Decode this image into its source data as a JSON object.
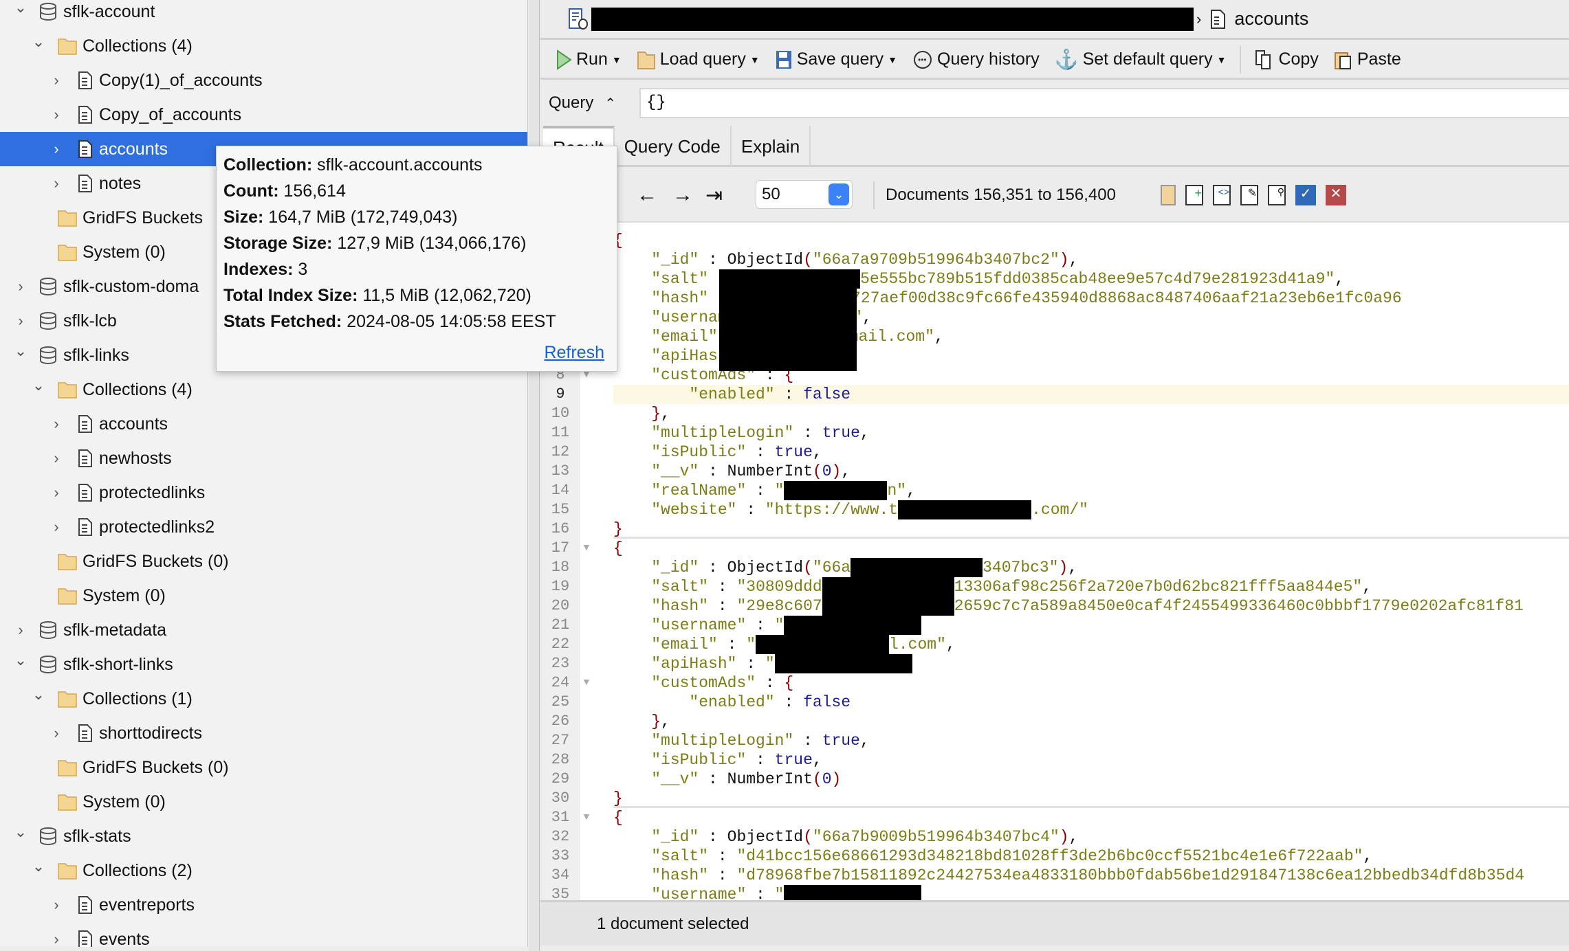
{
  "tree": [
    {
      "level": 0,
      "kind": "db",
      "expanded": true,
      "label": "sflk-account"
    },
    {
      "level": 1,
      "kind": "folder",
      "expanded": true,
      "label": "Collections (4)"
    },
    {
      "level": 2,
      "kind": "coll",
      "label": "Copy(1)_of_accounts"
    },
    {
      "level": 2,
      "kind": "coll",
      "label": "Copy_of_accounts"
    },
    {
      "level": 2,
      "kind": "coll",
      "label": "accounts",
      "selected": true
    },
    {
      "level": 2,
      "kind": "coll",
      "label": "notes"
    },
    {
      "level": 1,
      "kind": "folder",
      "leaf": true,
      "label": "GridFS Buckets"
    },
    {
      "level": 1,
      "kind": "folder",
      "leaf": true,
      "label": "System (0)"
    },
    {
      "level": 0,
      "kind": "db",
      "expanded": false,
      "label": "sflk-custom-doma"
    },
    {
      "level": 0,
      "kind": "db",
      "expanded": false,
      "label": "sflk-lcb"
    },
    {
      "level": 0,
      "kind": "db",
      "expanded": true,
      "label": "sflk-links"
    },
    {
      "level": 1,
      "kind": "folder",
      "expanded": true,
      "label": "Collections (4)"
    },
    {
      "level": 2,
      "kind": "coll",
      "label": "accounts"
    },
    {
      "level": 2,
      "kind": "coll",
      "label": "newhosts"
    },
    {
      "level": 2,
      "kind": "coll",
      "label": "protectedlinks"
    },
    {
      "level": 2,
      "kind": "coll",
      "label": "protectedlinks2"
    },
    {
      "level": 1,
      "kind": "folder",
      "leaf": true,
      "label": "GridFS Buckets (0)"
    },
    {
      "level": 1,
      "kind": "folder",
      "leaf": true,
      "label": "System (0)"
    },
    {
      "level": 0,
      "kind": "db",
      "expanded": false,
      "label": "sflk-metadata"
    },
    {
      "level": 0,
      "kind": "db",
      "expanded": true,
      "label": "sflk-short-links"
    },
    {
      "level": 1,
      "kind": "folder",
      "expanded": true,
      "label": "Collections (1)"
    },
    {
      "level": 2,
      "kind": "coll",
      "label": "shorttodirects"
    },
    {
      "level": 1,
      "kind": "folder",
      "leaf": true,
      "label": "GridFS Buckets (0)"
    },
    {
      "level": 1,
      "kind": "folder",
      "leaf": true,
      "label": "System (0)"
    },
    {
      "level": 0,
      "kind": "db",
      "expanded": true,
      "label": "sflk-stats"
    },
    {
      "level": 1,
      "kind": "folder",
      "expanded": true,
      "label": "Collections (2)"
    },
    {
      "level": 2,
      "kind": "coll",
      "label": "eventreports"
    },
    {
      "level": 2,
      "kind": "coll",
      "label": "events"
    }
  ],
  "tooltip": {
    "lines": [
      {
        "label": "Collection:",
        "value": " sflk-account.accounts"
      },
      {
        "label": "Count:",
        "value": " 156,614"
      },
      {
        "label": "Size:",
        "value": " 164,7 MiB  (172,749,043)"
      },
      {
        "label": "Storage Size:",
        "value": " 127,9 MiB  (134,066,176)"
      },
      {
        "label": "Indexes:",
        "value": " 3"
      },
      {
        "label": "Total Index Size:",
        "value": " 11,5 MiB  (12,062,720)"
      },
      {
        "label": "Stats Fetched:",
        "value": " 2024-08-05 14:05:58 EEST"
      }
    ],
    "refresh": "Refresh"
  },
  "titlebar": {
    "collection": "accounts"
  },
  "toolbar": {
    "run": "Run",
    "load": "Load query",
    "save": "Save query",
    "history": "Query history",
    "set_default": "Set default query",
    "copy": "Copy",
    "paste": "Paste"
  },
  "query": {
    "label": "Query",
    "value": "{}"
  },
  "tabs": [
    "Result",
    "Query Code",
    "Explain"
  ],
  "pager": {
    "page_size": "50",
    "range": "Documents 156,351 to 156,400"
  },
  "status": "1 document selected",
  "colors": {
    "selection": "#2f6fe0",
    "key": "#7d7d16",
    "brace": "#8b0000",
    "literal": "#1c1c9a",
    "highlight_line": "#fdf8e4"
  },
  "highlighted_line": 9,
  "code": [
    [
      [
        "p",
        "{"
      ]
    ],
    [
      [
        "i",
        "    "
      ],
      [
        "k",
        "\"_id\""
      ],
      [
        "c",
        " : "
      ],
      [
        "f",
        "ObjectId"
      ],
      [
        "p",
        "("
      ],
      [
        "s",
        "\"66a7a9709b519964b3407bc2\""
      ],
      [
        "p",
        ")"
      ],
      [
        "c",
        ","
      ]
    ],
    [
      [
        "i",
        "    "
      ],
      [
        "k",
        "\"salt\""
      ],
      [
        "c",
        " : "
      ],
      [
        "s",
        "\"b"
      ],
      [
        "x",
        ""
      ],
      [
        "s",
        "5e555bc789b515fdd0385cab48ee9e57c4d79e281923d41a9\""
      ],
      [
        "c",
        ","
      ]
    ],
    [
      [
        "i",
        "    "
      ],
      [
        "k",
        "\"hash\""
      ],
      [
        "c",
        " : "
      ],
      [
        "s",
        "\"0"
      ],
      [
        "x",
        ""
      ],
      [
        "s",
        "5f592727aef00d38c9fc66fe435940d8868ac8487406aaf21a23eb6e1fc0a96"
      ]
    ],
    [
      [
        "i",
        "    "
      ],
      [
        "k",
        "\"username\""
      ],
      [
        "x",
        ""
      ],
      [
        "s",
        "\""
      ],
      [
        "c",
        ","
      ]
    ],
    [
      [
        "i",
        "    "
      ],
      [
        "k",
        "\"email\""
      ],
      [
        "c",
        " : "
      ],
      [
        "s",
        "\""
      ],
      [
        "x",
        ""
      ],
      [
        "s",
        "@gmail.com\""
      ],
      [
        "c",
        ","
      ]
    ],
    [
      [
        "i",
        "    "
      ],
      [
        "k",
        "\"apiHash\""
      ],
      [
        "c",
        " :"
      ],
      [
        "x",
        ""
      ]
    ],
    [
      [
        "i",
        "    "
      ],
      [
        "k",
        "\"customAds\""
      ],
      [
        "c",
        " : "
      ],
      [
        "p",
        "{"
      ]
    ],
    [
      [
        "i",
        "        "
      ],
      [
        "k",
        "\"enabled\""
      ],
      [
        "c",
        " : "
      ],
      [
        "b",
        "false"
      ]
    ],
    [
      [
        "i",
        "    "
      ],
      [
        "p",
        "}"
      ],
      [
        "c",
        ","
      ]
    ],
    [
      [
        "i",
        "    "
      ],
      [
        "k",
        "\"multipleLogin\""
      ],
      [
        "c",
        " : "
      ],
      [
        "b",
        "true"
      ],
      [
        "c",
        ","
      ]
    ],
    [
      [
        "i",
        "    "
      ],
      [
        "k",
        "\"isPublic\""
      ],
      [
        "c",
        " : "
      ],
      [
        "b",
        "true"
      ],
      [
        "c",
        ","
      ]
    ],
    [
      [
        "i",
        "    "
      ],
      [
        "k",
        "\"__v\""
      ],
      [
        "c",
        " : "
      ],
      [
        "f",
        "NumberInt"
      ],
      [
        "p",
        "("
      ],
      [
        "n",
        "0"
      ],
      [
        "p",
        ")"
      ],
      [
        "c",
        ","
      ]
    ],
    [
      [
        "i",
        "    "
      ],
      [
        "k",
        "\"realName\""
      ],
      [
        "c",
        " : "
      ],
      [
        "s",
        "\""
      ],
      [
        "x",
        ""
      ],
      [
        "s",
        "n\""
      ],
      [
        "c",
        ","
      ]
    ],
    [
      [
        "i",
        "    "
      ],
      [
        "k",
        "\"website\""
      ],
      [
        "c",
        " : "
      ],
      [
        "s",
        "\"https://www.t"
      ],
      [
        "x",
        ""
      ],
      [
        "s",
        ".com/\""
      ]
    ],
    [
      [
        "p",
        "}"
      ]
    ],
    [
      [
        "p",
        "{"
      ]
    ],
    [
      [
        "i",
        "    "
      ],
      [
        "k",
        "\"_id\""
      ],
      [
        "c",
        " : "
      ],
      [
        "f",
        "ObjectId"
      ],
      [
        "p",
        "("
      ],
      [
        "s",
        "\"66a"
      ],
      [
        "x",
        ""
      ],
      [
        "s",
        "3407bc3\""
      ],
      [
        "p",
        ")"
      ],
      [
        "c",
        ","
      ]
    ],
    [
      [
        "i",
        "    "
      ],
      [
        "k",
        "\"salt\""
      ],
      [
        "c",
        " : "
      ],
      [
        "s",
        "\"30809ddd"
      ],
      [
        "x",
        ""
      ],
      [
        "s",
        "13306af98c256f2a720e7b0d62bc821fff5aa844e5\""
      ],
      [
        "c",
        ","
      ]
    ],
    [
      [
        "i",
        "    "
      ],
      [
        "k",
        "\"hash\""
      ],
      [
        "c",
        " : "
      ],
      [
        "s",
        "\"29e8c607"
      ],
      [
        "x",
        ""
      ],
      [
        "s",
        "2659c7c7a589a8450e0caf4f2455499336460c0bbbf1779e0202afc81f81"
      ]
    ],
    [
      [
        "i",
        "    "
      ],
      [
        "k",
        "\"username\""
      ],
      [
        "c",
        " : "
      ],
      [
        "s",
        "\""
      ],
      [
        "x",
        ""
      ]
    ],
    [
      [
        "i",
        "    "
      ],
      [
        "k",
        "\"email\""
      ],
      [
        "c",
        " : "
      ],
      [
        "s",
        "\""
      ],
      [
        "x",
        ""
      ],
      [
        "s",
        "l.com\""
      ],
      [
        "c",
        ","
      ]
    ],
    [
      [
        "i",
        "    "
      ],
      [
        "k",
        "\"apiHash\""
      ],
      [
        "c",
        " : "
      ],
      [
        "s",
        "\""
      ],
      [
        "x",
        ""
      ]
    ],
    [
      [
        "i",
        "    "
      ],
      [
        "k",
        "\"customAds\""
      ],
      [
        "c",
        " : "
      ],
      [
        "p",
        "{"
      ]
    ],
    [
      [
        "i",
        "        "
      ],
      [
        "k",
        "\"enabled\""
      ],
      [
        "c",
        " : "
      ],
      [
        "b",
        "false"
      ]
    ],
    [
      [
        "i",
        "    "
      ],
      [
        "p",
        "}"
      ],
      [
        "c",
        ","
      ]
    ],
    [
      [
        "i",
        "    "
      ],
      [
        "k",
        "\"multipleLogin\""
      ],
      [
        "c",
        " : "
      ],
      [
        "b",
        "true"
      ],
      [
        "c",
        ","
      ]
    ],
    [
      [
        "i",
        "    "
      ],
      [
        "k",
        "\"isPublic\""
      ],
      [
        "c",
        " : "
      ],
      [
        "b",
        "true"
      ],
      [
        "c",
        ","
      ]
    ],
    [
      [
        "i",
        "    "
      ],
      [
        "k",
        "\"__v\""
      ],
      [
        "c",
        " : "
      ],
      [
        "f",
        "NumberInt"
      ],
      [
        "p",
        "("
      ],
      [
        "n",
        "0"
      ],
      [
        "p",
        ")"
      ]
    ],
    [
      [
        "p",
        "}"
      ]
    ],
    [
      [
        "p",
        "{"
      ]
    ],
    [
      [
        "i",
        "    "
      ],
      [
        "k",
        "\"_id\""
      ],
      [
        "c",
        " : "
      ],
      [
        "f",
        "ObjectId"
      ],
      [
        "p",
        "("
      ],
      [
        "s",
        "\"66a7b9009b519964b3407bc4\""
      ],
      [
        "p",
        ")"
      ],
      [
        "c",
        ","
      ]
    ],
    [
      [
        "i",
        "    "
      ],
      [
        "k",
        "\"salt\""
      ],
      [
        "c",
        " : "
      ],
      [
        "s",
        "\"d41bcc156e68661293d348218bd81028ff3de2b6bc0ccf5521bc4e1e6f722aab\""
      ],
      [
        "c",
        ","
      ]
    ],
    [
      [
        "i",
        "    "
      ],
      [
        "k",
        "\"hash\""
      ],
      [
        "c",
        " : "
      ],
      [
        "s",
        "\"d78968fbe7b15811892c24427534ea4833180bbb0fdab56be1d291847138c6ea12bbedb34dfd8b35d4"
      ]
    ],
    [
      [
        "i",
        "    "
      ],
      [
        "k",
        "\"username\""
      ],
      [
        "c",
        " : "
      ],
      [
        "s",
        "\""
      ],
      [
        "x",
        ""
      ]
    ]
  ]
}
